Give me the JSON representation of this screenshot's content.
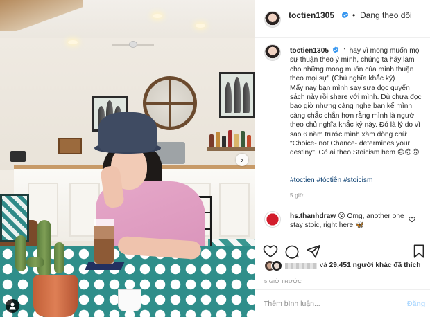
{
  "header": {
    "username": "toctien1305",
    "separator": "•",
    "follow_status": "Đang theo dõi"
  },
  "caption": {
    "username": "toctien1305",
    "text": "\"Thay vì mong muốn mọi sự thuận theo ý mình, chúng ta hãy làm cho những mong muốn của mình thuận theo mọi sự\" (Chủ nghĩa khắc kỷ)\nMấy nay bạn mình say sưa đọc quyển sách này rồi share với mình. Dù chưa đọc bao giờ nhưng càng nghe bạn kể mình càng chắc chắn hơn rằng mình là người theo chủ nghĩa khắc kỷ này. Đó là lý do vì sao 6 năm trước mình xăm dòng chữ \"Choice- not Chance- determines your destiny\". Có ai theo Stoicism hem",
    "emojis": "🙃🙃🙃",
    "hashtags": "#toctien #tóctiên #stoicism",
    "time": "5 giờ"
  },
  "comment": {
    "username": "hs.thanhdraw",
    "emoji": "😮",
    "text": "Omg, another one stay stoic, right here",
    "trailing_emoji": "🦋"
  },
  "likes": {
    "count": "29,451",
    "prefix": "và",
    "suffix": "người khác đã thích"
  },
  "post_time": "5 GIỜ TRƯỚC",
  "add_comment": {
    "placeholder": "Thêm bình luận...",
    "post_label": "Đăng"
  },
  "icons": {
    "verified": "verified-badge-icon",
    "like": "heart-icon",
    "comment": "comment-icon",
    "share": "paper-plane-icon",
    "save": "bookmark-icon",
    "carousel_next": "chevron-right-icon",
    "user_tags": "person-icon"
  },
  "colors": {
    "verified_blue": "#3897f0",
    "link": "#00376b",
    "muted": "#8e8e8e",
    "post_disabled": "#b3dbff"
  }
}
